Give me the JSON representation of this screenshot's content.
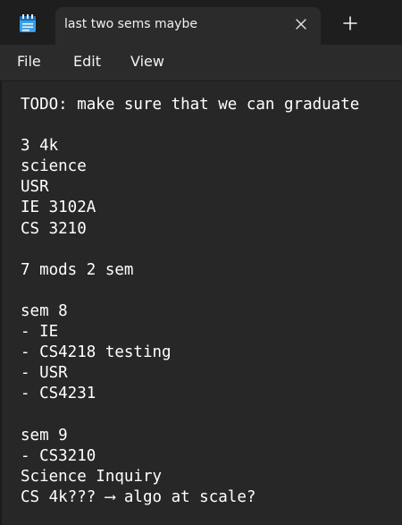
{
  "tab": {
    "title": "last two sems maybe",
    "app_icon": "notepad-icon",
    "close_icon": "close-icon",
    "new_tab_icon": "plus-icon"
  },
  "menu": {
    "file": "File",
    "edit": "Edit",
    "view": "View"
  },
  "document": {
    "lines": [
      "TODO: make sure that we can graduate",
      "",
      "3 4k",
      "science",
      "USR",
      "IE 3102A",
      "CS 3210",
      "",
      "7 mods 2 sem",
      "",
      "sem 8",
      "- IE",
      "- CS4218 testing",
      "- USR",
      "- CS4231",
      "",
      "sem 9",
      "- CS3210",
      "Science Inquiry",
      "CS 4k??? ⟶ algo at scale?"
    ]
  },
  "colors": {
    "background": "#272727",
    "tabstrip": "#1e1e1e",
    "text": "#ffffff",
    "icon_blue": "#4cc2ff"
  }
}
